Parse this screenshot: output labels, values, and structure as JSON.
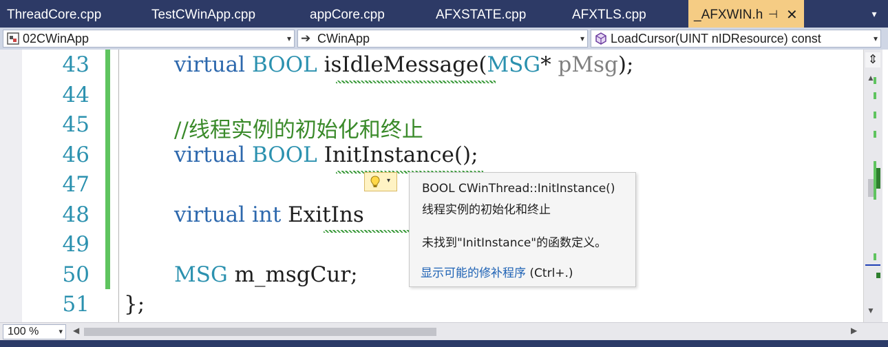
{
  "tabs": [
    {
      "label": "ThreadCore.cpp",
      "active": false
    },
    {
      "label": "TestCWinApp.cpp",
      "active": false
    },
    {
      "label": "appCore.cpp",
      "active": false
    },
    {
      "label": "AFXSTATE.cpp",
      "active": false
    },
    {
      "label": "AFXTLS.cpp",
      "active": false
    },
    {
      "label": "_AFXWIN.h",
      "active": true
    }
  ],
  "active_tab_pin_glyph": "⊣",
  "active_tab_close_glyph": "✕",
  "tab_overflow_glyph": "▾",
  "navbar": {
    "project": "02CWinApp",
    "scope": "CWinApp",
    "member": "LoadCursor(UINT nIDResource) const",
    "dropdown_glyph": "▾",
    "scope_icon_glyph": "➔"
  },
  "editor": {
    "line_numbers": [
      "43",
      "44",
      "45",
      "46",
      "47",
      "48",
      "49",
      "50",
      "51"
    ],
    "code": {
      "l43": {
        "kw": "virtual",
        "type": "BOOL",
        "name": "isIdleMessage",
        "paren_open": "(",
        "ptype": "MSG",
        "star": "*",
        "pname": "pMsg",
        "tail": ");"
      },
      "l45": {
        "comment": "//线程实例的初始化和终止"
      },
      "l46": {
        "kw": "virtual",
        "type": "BOOL",
        "name": "InitInstance",
        "tail": "();"
      },
      "l48": {
        "kw": "virtual",
        "type": "int",
        "name": "ExitIns"
      },
      "l50": {
        "type": "MSG",
        "name": "m_msgCur;"
      },
      "l51": {
        "text": "};"
      }
    }
  },
  "lightbulb": {
    "dropdown_glyph": "▾"
  },
  "tooltip": {
    "signature": "BOOL CWinThread::InitInstance()",
    "comment": "线程实例的初始化和终止",
    "message": "未找到\"InitInstance\"的函数定义。",
    "fix_link": "显示可能的修补程序",
    "fix_shortcut": "(Ctrl+.)"
  },
  "vscroll": {
    "split_glyph": "⇕",
    "up_glyph": "▲",
    "down_glyph": "▼"
  },
  "bottombar": {
    "zoom": "100 %",
    "zoom_dropdown": "▾",
    "left_glyph": "◀",
    "right_glyph": "▶"
  },
  "colors": {
    "tab_active_bg": "#f5cc84",
    "chrome_bg": "#2d3a66",
    "keyword": "#2d68ad",
    "type": "#2b91af",
    "comment": "#3a8a2a",
    "change_bar": "#5fc45f",
    "link": "#1f63b5"
  }
}
